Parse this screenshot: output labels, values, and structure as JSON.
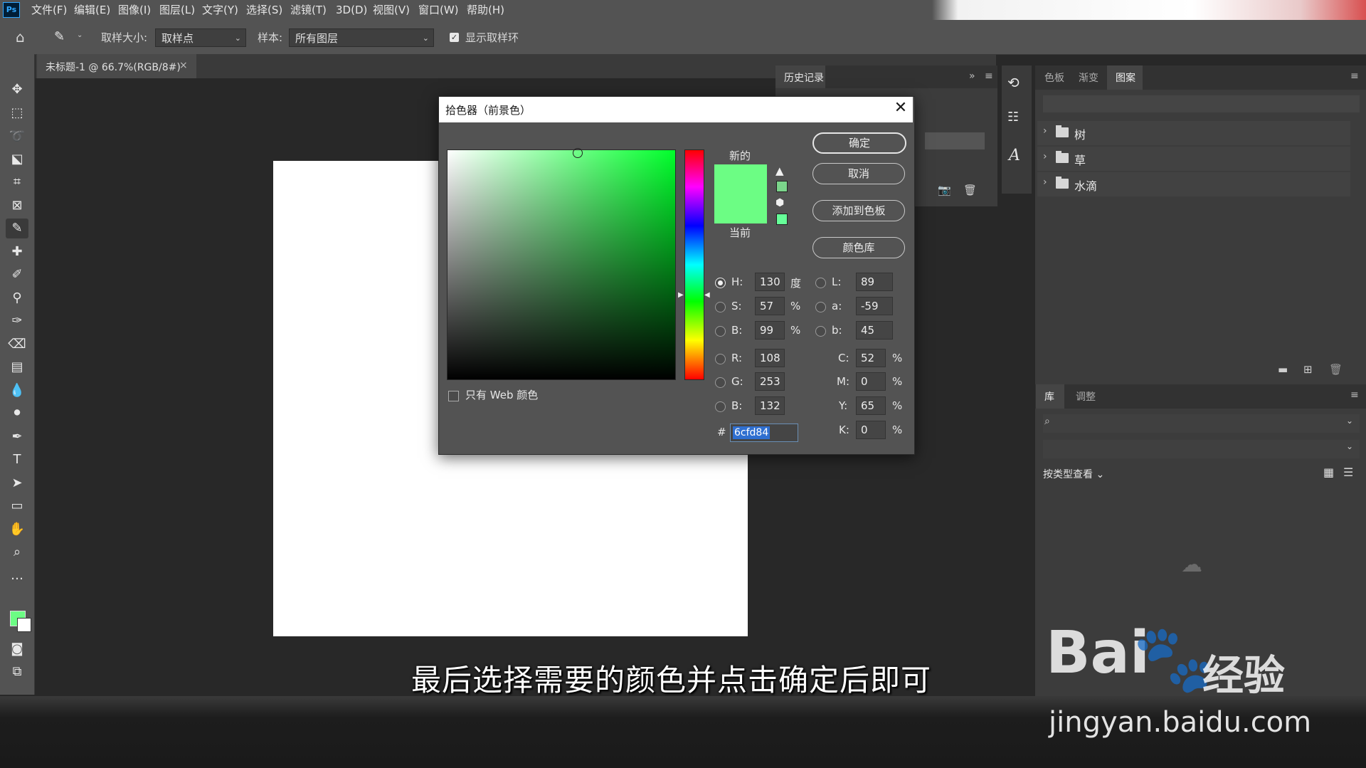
{
  "app": {
    "logo_text": "Ps"
  },
  "menu": [
    "文件(F)",
    "编辑(E)",
    "图像(I)",
    "图层(L)",
    "文字(Y)",
    "选择(S)",
    "滤镜(T)",
    "3D(D)",
    "视图(V)",
    "窗口(W)",
    "帮助(H)"
  ],
  "options_bar": {
    "sample_size_label": "取样大小:",
    "sample_size_value": "取样点",
    "sample_label": "样本:",
    "sample_value": "所有图层",
    "show_ring_label": "显示取样环",
    "show_ring_checked": true
  },
  "document_tab": {
    "title": "未标题-1 @ 66.7%(RGB/8#)",
    "close": "×"
  },
  "history_panel": {
    "tab": "历史记录"
  },
  "right_panel": {
    "tabs": [
      "色板",
      "渐变",
      "图案"
    ],
    "active_tab": "图案",
    "folders": [
      "树",
      "草",
      "水滴"
    ],
    "library_tabs": [
      "库",
      "调整"
    ],
    "view_by_label": "按类型查看"
  },
  "color_picker": {
    "title": "拾色器（前景色）",
    "label_new": "新的",
    "label_current": "当前",
    "new_color": "#6cfd84",
    "current_color": "#6cfd84",
    "buttons": {
      "ok": "确定",
      "cancel": "取消",
      "add_swatch": "添加到色板",
      "color_libraries": "颜色库"
    },
    "web_only_label": "只有 Web 颜色",
    "hsb": {
      "h_label": "H:",
      "h": "130",
      "h_unit": "度",
      "s_label": "S:",
      "s": "57",
      "s_unit": "%",
      "b_label": "B:",
      "b": "99",
      "b_unit": "%"
    },
    "rgb": {
      "r_label": "R:",
      "r": "108",
      "g_label": "G:",
      "g": "253",
      "b_label": "B:",
      "b": "132"
    },
    "lab": {
      "l_label": "L:",
      "l": "89",
      "a_label": "a:",
      "a": "-59",
      "b_label": "b:",
      "b": "45"
    },
    "cmyk": {
      "c_label": "C:",
      "c": "52",
      "m_label": "M:",
      "m": "0",
      "y_label": "Y:",
      "y": "65",
      "k_label": "K:",
      "k": "0",
      "unit": "%"
    },
    "hex_label": "#",
    "hex": "6cfd84"
  },
  "subtitle": "最后选择需要的颜色并点击确定后即可",
  "watermark": {
    "logo_a": "Bai",
    "logo_b": "经验",
    "url": "jingyan.baidu.com"
  }
}
